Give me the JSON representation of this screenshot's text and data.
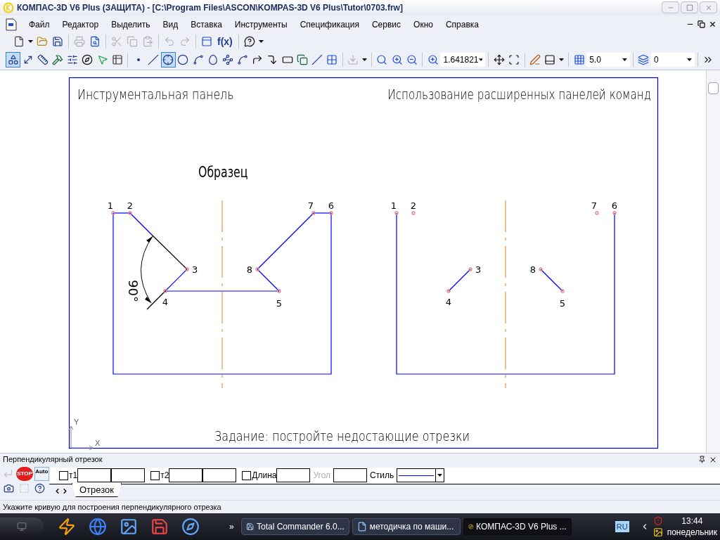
{
  "window": {
    "title": "КОМПАС-3D V6 Plus (ЗАЩИТА) - [C:\\Program Files\\ASCON\\KOMPAS-3D V6 Plus\\Tutor\\0703.frw]"
  },
  "menu": [
    {
      "label": "Файл"
    },
    {
      "label": "Редактор"
    },
    {
      "label": "Выделить"
    },
    {
      "label": "Вид"
    },
    {
      "label": "Вставка"
    },
    {
      "label": "Инструменты"
    },
    {
      "label": "Спецификация"
    },
    {
      "label": "Сервис"
    },
    {
      "label": "Окно"
    },
    {
      "label": "Справка"
    }
  ],
  "toolbar_standard": [
    {
      "kind": "new",
      "disabled": false
    },
    {
      "kind": "caret",
      "disabled": false
    },
    {
      "kind": "open",
      "disabled": false
    },
    {
      "kind": "save",
      "disabled": false
    },
    {
      "kind": "separator"
    },
    {
      "kind": "print",
      "disabled": true
    },
    {
      "kind": "preview",
      "disabled": false
    },
    {
      "kind": "separator"
    },
    {
      "kind": "cut",
      "disabled": true
    },
    {
      "kind": "copy",
      "disabled": true
    },
    {
      "kind": "paste",
      "disabled": true
    },
    {
      "kind": "separator"
    },
    {
      "kind": "undo",
      "disabled": true
    },
    {
      "kind": "redo",
      "disabled": true
    },
    {
      "kind": "separator"
    },
    {
      "kind": "panel",
      "disabled": false
    },
    {
      "kind": "text",
      "label": "f(x)",
      "disabled": false
    },
    {
      "kind": "separator"
    },
    {
      "kind": "help",
      "disabled": false
    },
    {
      "kind": "caret",
      "disabled": false
    }
  ],
  "toolbar_drawing": [
    {
      "kind": "geometry",
      "selected": true,
      "disabled": false
    },
    {
      "kind": "dimensions",
      "selected": false,
      "disabled": false
    },
    {
      "kind": "symbols",
      "selected": false,
      "disabled": false
    },
    {
      "kind": "edit",
      "selected": false,
      "disabled": false
    },
    {
      "kind": "params",
      "selected": false,
      "disabled": false
    },
    {
      "kind": "measure",
      "selected": false,
      "disabled": false
    },
    {
      "kind": "selection",
      "selected": false,
      "disabled": false
    },
    {
      "kind": "spec",
      "selected": false,
      "disabled": false
    },
    {
      "kind": "separator"
    },
    {
      "kind": "point",
      "selected": false,
      "disabled": false
    },
    {
      "kind": "aux_line",
      "selected": false,
      "disabled": false
    },
    {
      "kind": "perpendicular",
      "selected": true,
      "disabled": false
    },
    {
      "kind": "circle",
      "selected": false,
      "disabled": false
    },
    {
      "kind": "arc",
      "selected": false,
      "disabled": false
    },
    {
      "kind": "ellipse",
      "selected": false,
      "disabled": false
    },
    {
      "kind": "polyline",
      "selected": false,
      "disabled": false
    },
    {
      "kind": "spline",
      "selected": false,
      "disabled": false
    },
    {
      "kind": "chamfer",
      "selected": false,
      "disabled": false
    },
    {
      "kind": "fillet",
      "selected": false,
      "disabled": false
    },
    {
      "kind": "rectangle",
      "selected": false,
      "disabled": false
    },
    {
      "kind": "contour",
      "selected": false,
      "disabled": false
    },
    {
      "kind": "parallel",
      "selected": false,
      "disabled": false
    },
    {
      "kind": "hatch",
      "selected": false,
      "disabled": false
    },
    {
      "kind": "separator"
    },
    {
      "kind": "insert",
      "disabled": true
    },
    {
      "kind": "caret",
      "disabled": false
    },
    {
      "kind": "separator"
    },
    {
      "kind": "zoom_window",
      "disabled": false
    },
    {
      "kind": "zoom_in",
      "disabled": false
    },
    {
      "kind": "zoom_out",
      "disabled": false
    },
    {
      "kind": "separator"
    },
    {
      "kind": "zoom_scale",
      "disabled": false
    },
    {
      "kind": "combo",
      "value": "1.641821"
    },
    {
      "kind": "separator"
    },
    {
      "kind": "pan",
      "disabled": false
    },
    {
      "kind": "fit",
      "disabled": false
    },
    {
      "kind": "separator"
    },
    {
      "kind": "pen",
      "disabled": false
    },
    {
      "kind": "layout",
      "disabled": false
    },
    {
      "kind": "caret",
      "disabled": false
    },
    {
      "kind": "separator"
    },
    {
      "kind": "snap_step",
      "disabled": false
    },
    {
      "kind": "combo",
      "value": "5.0"
    },
    {
      "kind": "separator"
    },
    {
      "kind": "layers",
      "disabled": false
    },
    {
      "kind": "combo",
      "value": "0"
    },
    {
      "kind": "separator"
    },
    {
      "kind": "more",
      "disabled": false
    }
  ],
  "drawing": {
    "header_left": "Инструментальная панель",
    "header_right": "Использование расширенных панелей команд",
    "sample_label": "Образец",
    "angle_label": "90°",
    "task": "Задание: постройте недостающие отрезки",
    "axis_y": "Y",
    "axis_x": "X",
    "sample_points": [
      "1",
      "2",
      "3",
      "4",
      "5",
      "7",
      "6",
      "8"
    ],
    "task_points": [
      "1",
      "2",
      "3",
      "4",
      "5",
      "7",
      "6",
      "8"
    ]
  },
  "property_panel": {
    "title": "Перпендикулярный отрезок",
    "actions": [
      {
        "kind": "enter",
        "disabled": true
      },
      {
        "kind": "stop",
        "label": "STOP",
        "disabled": false
      },
      {
        "kind": "auto",
        "label": "Auto",
        "disabled": false
      }
    ],
    "tools": [
      {
        "kind": "camera",
        "disabled": false
      },
      {
        "kind": "grid",
        "disabled": true
      },
      {
        "kind": "help",
        "disabled": false
      }
    ],
    "fields": [
      {
        "kind": "checkbox",
        "label": "т1",
        "checked": false
      },
      {
        "kind": "input"
      },
      {
        "kind": "input"
      },
      {
        "kind": "checkbox",
        "label": "т2",
        "checked": false
      },
      {
        "kind": "input"
      },
      {
        "kind": "input"
      },
      {
        "kind": "checkbox",
        "label": "Длина",
        "checked": false
      },
      {
        "kind": "input"
      },
      {
        "kind": "label",
        "label": "Угол",
        "disabled": true
      },
      {
        "kind": "input"
      },
      {
        "kind": "label",
        "label": "Стиль",
        "disabled": false
      },
      {
        "kind": "style"
      }
    ],
    "tab": "Отрезок"
  },
  "status_bar": {
    "text": "Укажите кривую для построения перпендикулярного отрезка"
  },
  "taskbar": {
    "quick_launch": [
      {
        "kind": "winamp"
      },
      {
        "kind": "browser"
      },
      {
        "kind": "desktop"
      },
      {
        "kind": "floppy"
      },
      {
        "kind": "kompas"
      }
    ],
    "overflow": "»",
    "tasks": [
      {
        "kind": "commander",
        "label": "Total Commander 6.0...",
        "selected": false
      },
      {
        "kind": "word",
        "label": "методичка по маши...",
        "selected": false
      },
      {
        "kind": "kompas",
        "label": "КОМПАС-3D V6 Plus ...",
        "selected": true
      }
    ],
    "language": "RU",
    "time": "13:44",
    "day": "понедельник"
  }
}
